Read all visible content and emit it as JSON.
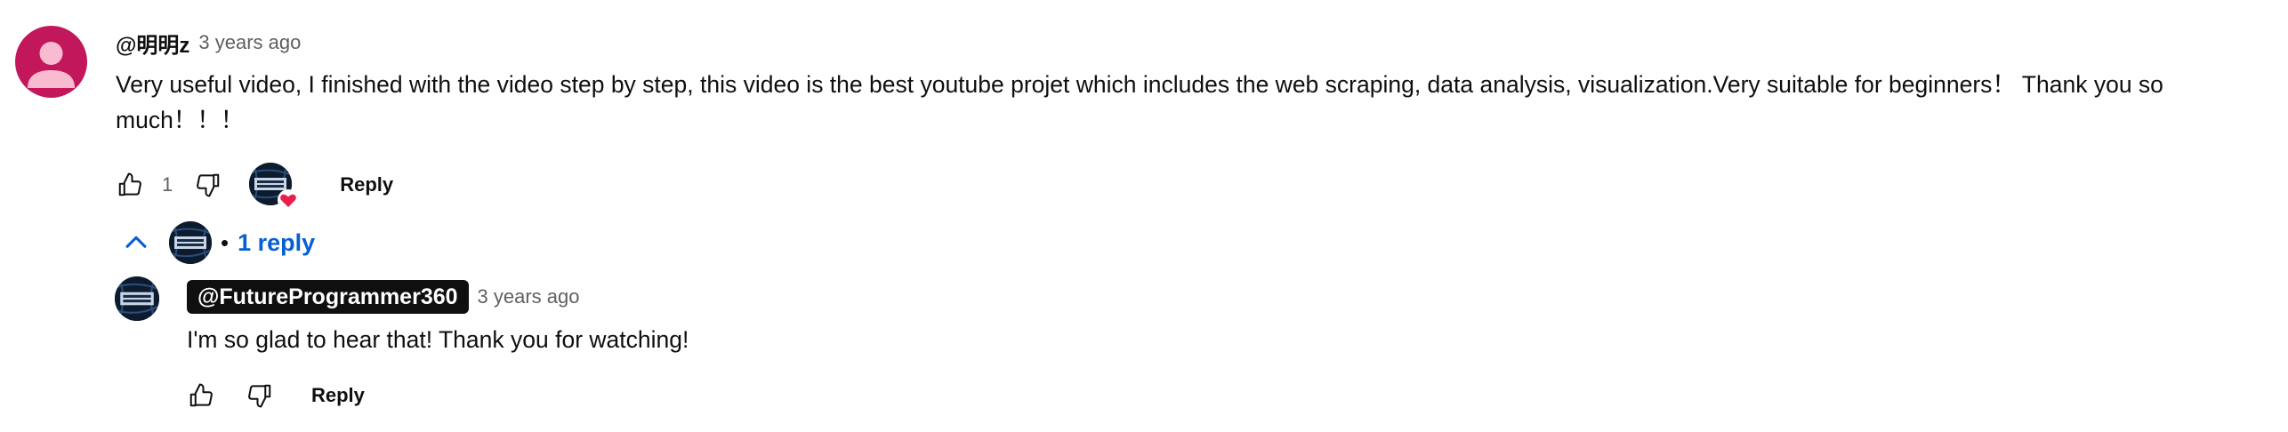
{
  "comment": {
    "author": "@明明z",
    "timestamp": "3 years ago",
    "text": "Very useful video, I finished with the video step by step, this video is the best youtube projet which includes the web scraping, data analysis, visualization.Very suitable for beginners！ Thank you so much！！！",
    "like_count": "1",
    "reply_label": "Reply",
    "avatar_color": "#c2185b",
    "creator_heart": true
  },
  "replies_toggle": {
    "icon": "chevron-up-icon",
    "separator": "•",
    "label": "1 reply",
    "color": "#065fd4"
  },
  "reply": {
    "author": "@FutureProgrammer360",
    "timestamp": "3 years ago",
    "text": "I'm so glad to hear that! Thank you for watching!",
    "reply_label": "Reply"
  },
  "icons": {
    "like": "thumb-up-icon",
    "dislike": "thumb-down-icon",
    "heart": "heart-icon"
  }
}
